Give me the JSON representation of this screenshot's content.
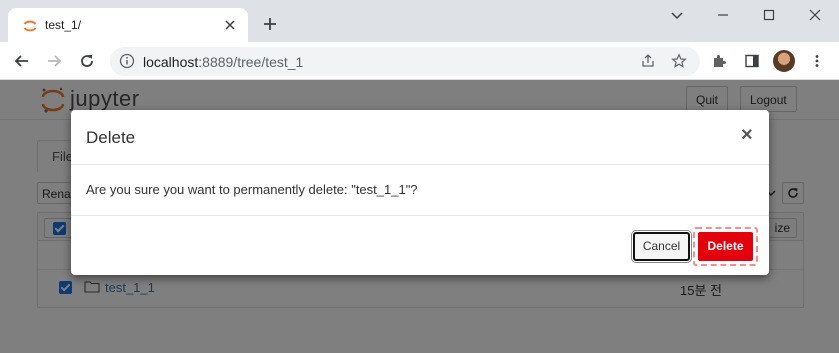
{
  "browser": {
    "tab_title": "test_1/",
    "url_host": "localhost",
    "url_rest": ":8889/tree/test_1"
  },
  "jupyter": {
    "logo_text": "jupyter",
    "quit_label": "Quit",
    "logout_label": "Logout",
    "files_tab_label": "Files",
    "rename_label": "Rename",
    "size_label": "ize",
    "items": [
      {
        "name": "test_1_1",
        "modified": "15분 전",
        "checked": true
      }
    ]
  },
  "modal": {
    "title": "Delete",
    "close_glyph": "×",
    "message": "Are you sure you want to permanently delete: \"test_1_1\"?",
    "cancel_label": "Cancel",
    "delete_label": "Delete"
  },
  "colors": {
    "delete_button": "#e3010e",
    "link": "#337ab7",
    "checkbox": "#1a73e8",
    "jupyter_orange": "#f37726"
  }
}
